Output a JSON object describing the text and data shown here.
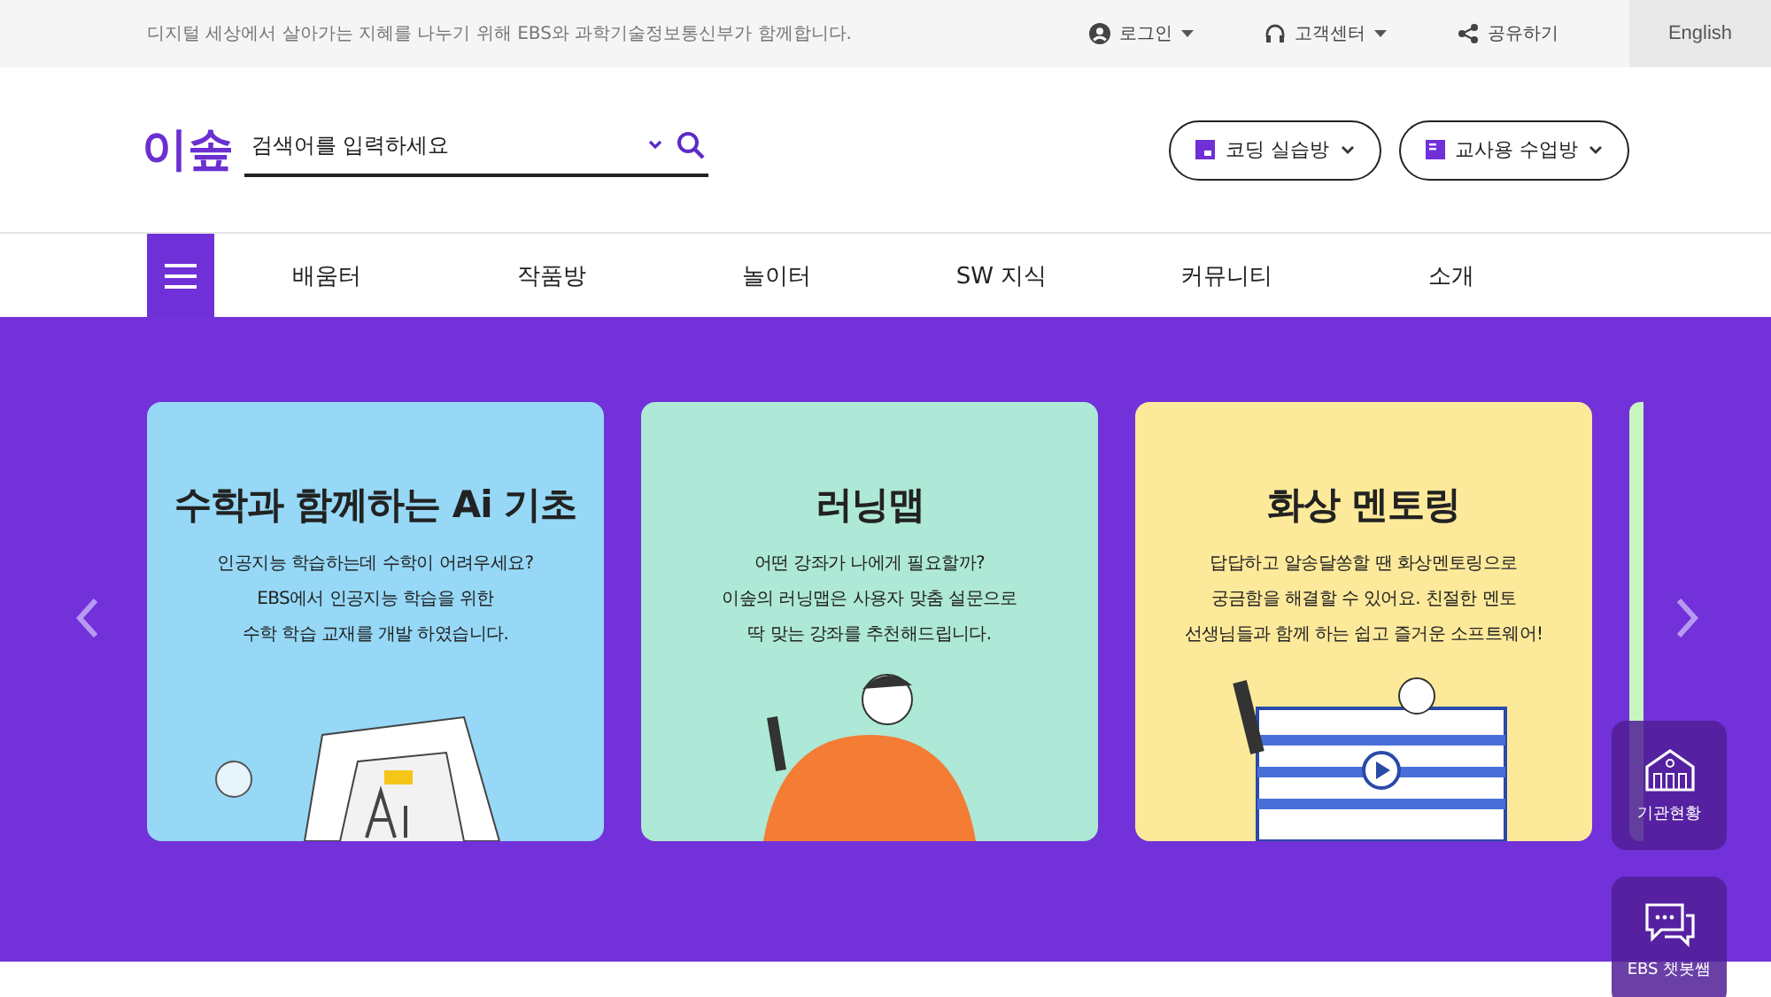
{
  "top_bar": {
    "tagline": "디지털 세상에서 살아가는 지혜를 나누기 위해 EBS와 과학기술정보통신부가 함께합니다.",
    "links": [
      {
        "kind": "login",
        "label": "로그인",
        "dropdown": true
      },
      {
        "kind": "support",
        "label": "고객센터",
        "dropdown": true
      },
      {
        "kind": "share",
        "label": "공유하기",
        "dropdown": false
      }
    ],
    "language": "English"
  },
  "header": {
    "logo": "이솦",
    "search": {
      "placeholder": "검색어를 입력하세요"
    },
    "buttons": [
      {
        "kind": "coding",
        "label": "코딩 실습방"
      },
      {
        "kind": "teacher",
        "label": "교사용 수업방"
      }
    ]
  },
  "nav": {
    "items": [
      "배움터",
      "작품방",
      "놀이터",
      "SW 지식",
      "커뮤니티",
      "소개"
    ]
  },
  "carousel": {
    "cards": [
      {
        "kind": "math",
        "title": "수학과 함께하는 Ai 기초",
        "lines": [
          "인공지능 학습하는데 수학이 어려우세요?",
          "EBS에서 인공지능 학습을 위한",
          "수학 학습 교재를 개발 하였습니다."
        ],
        "color": "#96d8f6"
      },
      {
        "kind": "map",
        "title": "러닝맵",
        "lines": [
          "어떤 강좌가 나에게 필요할까?",
          "이솦의 러닝맵은 사용자 맞춤 설문으로",
          "딱 맞는 강좌를 추천해드립니다."
        ],
        "color": "#aee8d6"
      },
      {
        "kind": "mentor",
        "title": "화상 멘토링",
        "lines": [
          "답답하고 알송달쏭할 땐 화상멘토링으로",
          "궁금함을 해결할 수 있어요. 친절한 멘토",
          "선생님들과 함께 하는 쉽고 즐거운 소프트웨어!"
        ],
        "color": "#fde99a"
      }
    ]
  },
  "floating": [
    {
      "kind": "institution",
      "label": "기관현황"
    },
    {
      "kind": "chat",
      "label": "EBS 챗봇쌤"
    }
  ]
}
